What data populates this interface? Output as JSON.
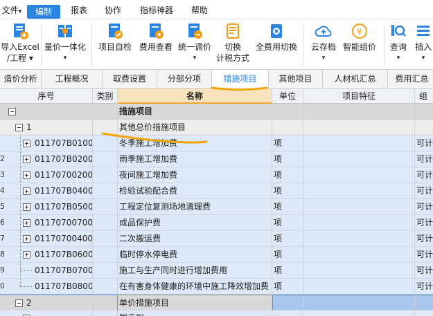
{
  "menubar": {
    "items": [
      {
        "label": "文件",
        "suffix": "▾"
      },
      {
        "label": "编制",
        "active": true
      },
      {
        "label": "报表"
      },
      {
        "label": "协作"
      },
      {
        "label": "指标神器"
      },
      {
        "label": "帮助"
      }
    ]
  },
  "ribbon": {
    "buttons": [
      {
        "line1": "导入Excel",
        "line2": "/工程 ▾",
        "icon": "import-excel-icon"
      },
      {
        "line1": "量价一体化",
        "line2": "▾",
        "icon": "price-integration-icon"
      },
      {
        "line1": "项目自检",
        "line2": "",
        "icon": "project-check-icon"
      },
      {
        "line1": "费用查看",
        "line2": "",
        "icon": "fee-view-icon"
      },
      {
        "line1": "统一调价",
        "line2": "▾",
        "icon": "unify-price-icon"
      },
      {
        "line1": "切换",
        "line2": "计税方式",
        "icon": "tax-switch-icon"
      },
      {
        "line1": "全费用切换",
        "line2": "",
        "icon": "full-fee-switch-icon"
      },
      {
        "line1": "云存档",
        "line2": "▾",
        "icon": "cloud-archive-icon"
      },
      {
        "line1": "智能组价",
        "line2": "",
        "icon": "smart-price-icon"
      },
      {
        "line1": "查询",
        "line2": "▾",
        "icon": "query-icon"
      },
      {
        "line1": "插入",
        "line2": "▾",
        "icon": "insert-icon"
      }
    ]
  },
  "tabs": [
    "造价分析",
    "工程概况",
    "取费设置",
    "分部分项",
    "措施项目",
    "其他项目",
    "人材机汇总",
    "费用汇总"
  ],
  "active_tab": "措施项目",
  "grid": {
    "headers": {
      "seq": "序号",
      "type": "类别",
      "name": "名称",
      "unit": "单位",
      "feature": "项目特征",
      "extra": "组"
    },
    "rows": [
      {
        "left": "",
        "seq": "",
        "name": "措施项目",
        "unit": "",
        "extra": "",
        "kind": "level0"
      },
      {
        "left": "",
        "seq": "1",
        "name": "其他总价措施项目",
        "unit": "",
        "extra": "",
        "kind": "level1"
      },
      {
        "left": "",
        "seq": "011707B01001",
        "name": "冬季施工增加费",
        "unit": "项",
        "extra": "可计",
        "kind": "detail"
      },
      {
        "left": "2",
        "seq": "011707B02001",
        "name": "雨季施工增加费",
        "unit": "项",
        "extra": "可计",
        "kind": "detail"
      },
      {
        "left": "3",
        "seq": "011707002001",
        "name": "夜间施工增加费",
        "unit": "项",
        "extra": "可计",
        "kind": "detail"
      },
      {
        "left": "4",
        "seq": "011707B04001",
        "name": "检验试验配合费",
        "unit": "项",
        "extra": "可计",
        "kind": "detail"
      },
      {
        "left": "5",
        "seq": "011707B05001",
        "name": "工程定位复测场地清理费",
        "unit": "项",
        "extra": "可计",
        "kind": "detail"
      },
      {
        "left": "6",
        "seq": "011707007001",
        "name": "成品保护费",
        "unit": "项",
        "extra": "可计",
        "kind": "detail"
      },
      {
        "left": "7",
        "seq": "011707004001",
        "name": "二次搬运费",
        "unit": "项",
        "extra": "可计",
        "kind": "detail"
      },
      {
        "left": "8",
        "seq": "011707B06001",
        "name": "临时停水停电费",
        "unit": "项",
        "extra": "可计",
        "kind": "detail"
      },
      {
        "left": "9",
        "seq": "011707B07001",
        "name": "施工与生产同时进行增加费用",
        "unit": "项",
        "extra": "可计",
        "kind": "detail"
      },
      {
        "left": "0",
        "seq": "011707B08001",
        "name": "在有害身体健康的环境中施工降效增加费",
        "unit": "项",
        "extra": "可计",
        "kind": "detail"
      },
      {
        "left": "",
        "seq": "2",
        "name": "单价措施项目",
        "unit": "",
        "extra": "",
        "kind": "selected"
      },
      {
        "left": "",
        "seq": "",
        "name": "脚手架",
        "unit": "",
        "extra": "",
        "kind": "detail"
      }
    ]
  },
  "colors": {
    "accent": "#2b84e0",
    "highlight": "#f0a63a",
    "annotation": "#f2a400"
  }
}
